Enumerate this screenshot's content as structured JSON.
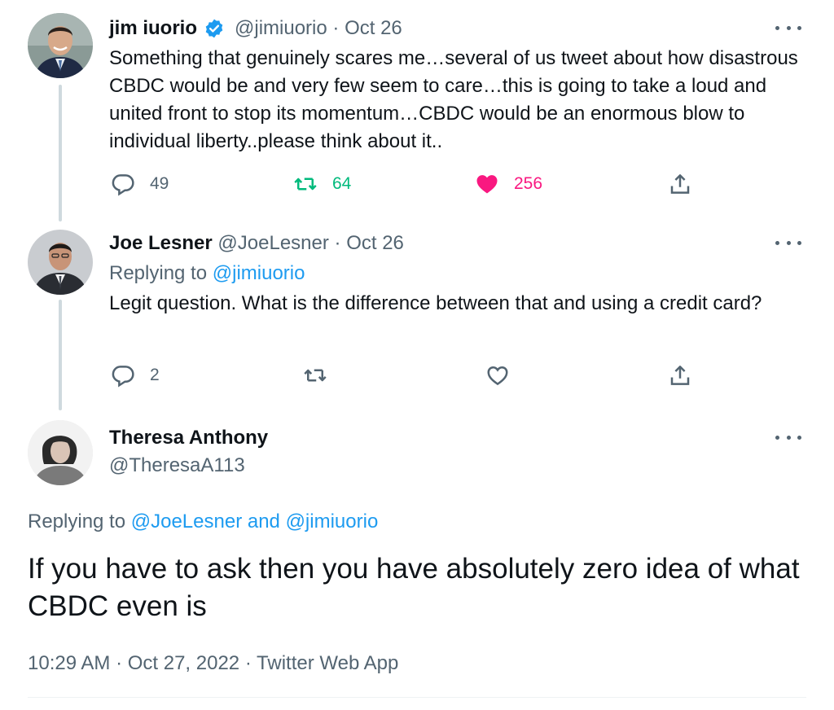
{
  "tweet1": {
    "name": "jim iuorio",
    "handle": "@jimiuorio",
    "separator": "·",
    "date": "Oct 26",
    "text": "Something that genuinely scares me…several of us tweet about how disastrous CBDC would be and very few seem to care…this is going to take a loud and united front to stop its momentum…CBDC would be an enormous blow to individual liberty..please think about it..",
    "replies": "49",
    "retweets": "64",
    "likes": "256",
    "icons": {
      "reply": "reply-icon",
      "retweet": "retweet-icon",
      "like": "heart-filled-icon",
      "share": "share-icon",
      "verified": "verified-badge-icon"
    },
    "colors": {
      "retweet": "#00ba7c",
      "like": "#f91880"
    }
  },
  "tweet2": {
    "name": "Joe Lesner",
    "handle": "@JoeLesner",
    "separator": "·",
    "date": "Oct 26",
    "replying_prefix": "Replying to",
    "replying_to": "@jimiuorio",
    "text": "Legit question. What is the difference between that and using a credit card?",
    "replies": "2",
    "icons": {
      "reply": "reply-icon",
      "retweet": "retweet-icon",
      "like": "heart-icon",
      "share": "share-icon"
    }
  },
  "tweet3": {
    "name": "Theresa Anthony",
    "handle": "@TheresaA113",
    "replying_prefix": "Replying to",
    "replying_to": "@JoeLesner and @jimiuorio",
    "text": "If you have to ask then you have absolutely zero idea of what CBDC even is",
    "timestamp": "10:29 AM · Oct 27, 2022 · Twitter Web App"
  },
  "theme": {
    "accent": "#1d9bf0",
    "muted": "#536471",
    "thread_line": "#cfd9de"
  }
}
